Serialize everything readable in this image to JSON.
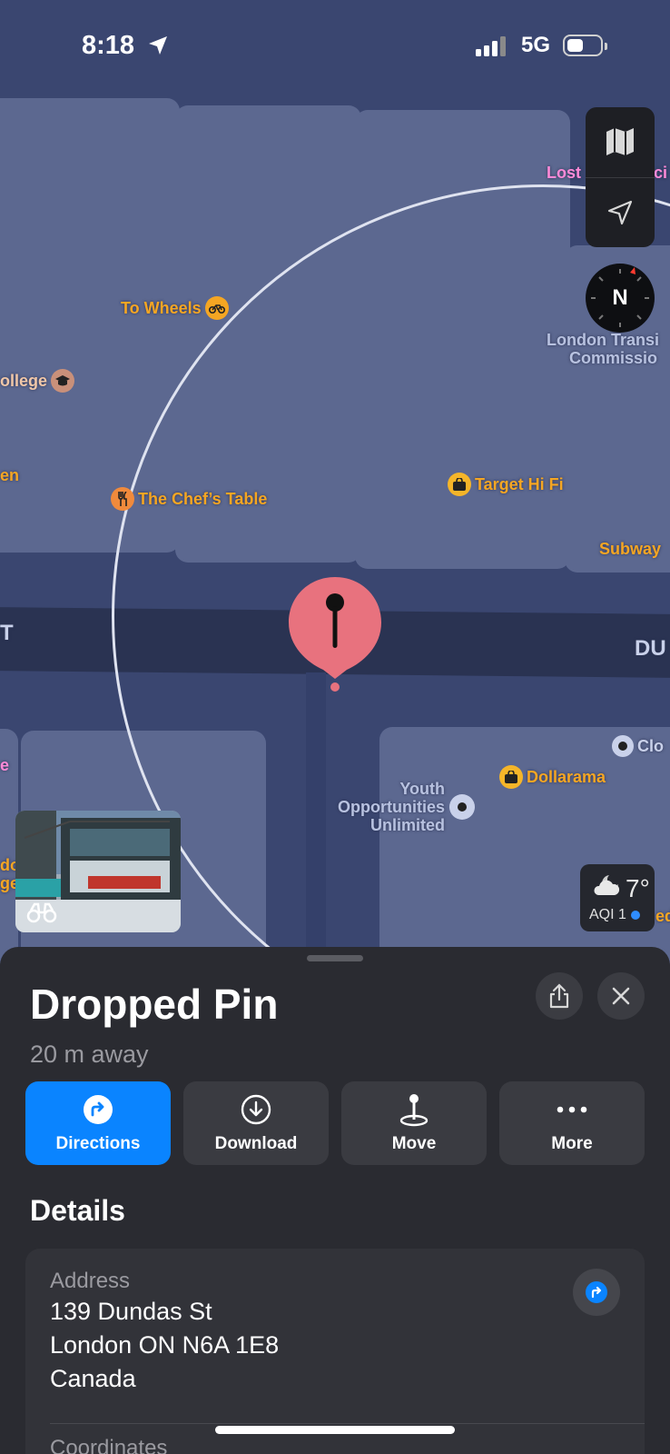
{
  "status_bar": {
    "time": "8:18",
    "network": "5G"
  },
  "map": {
    "labels": {
      "to_wheels": "To Wheels",
      "college": "ollege",
      "en": "en",
      "chefs_table": "The Chef’s Table",
      "target_hifi": "Target Hi Fi",
      "subway": "Subway",
      "lost": "Lost",
      "ci": "ci",
      "london_transit": "London Transi",
      "commission": "Commissio",
      "street_t": "T",
      "street_du": "DU",
      "dollarama": "Dollarama",
      "clo": "Clo",
      "youth1": "Youth",
      "youth2": "Opportunities",
      "youth3": "Unlimited",
      "e": "e",
      "do": "do",
      "ge": "ge",
      "ed": "ed"
    },
    "compass_letter": "N",
    "weather": {
      "temp": "7°",
      "aqi": "AQI 1"
    }
  },
  "sheet": {
    "title": "Dropped Pin",
    "distance": "20 m away",
    "actions": {
      "directions": "Directions",
      "download": "Download",
      "move": "Move",
      "more": "More"
    },
    "details_heading": "Details",
    "address": {
      "label": "Address",
      "line1": "139 Dundas St",
      "line2": "London ON N6A 1E8",
      "line3": "Canada"
    },
    "coordinates_label": "Coordinates"
  },
  "colors": {
    "accent": "#0a84ff",
    "pin": "#e8727e",
    "poi": "#f5a623"
  }
}
